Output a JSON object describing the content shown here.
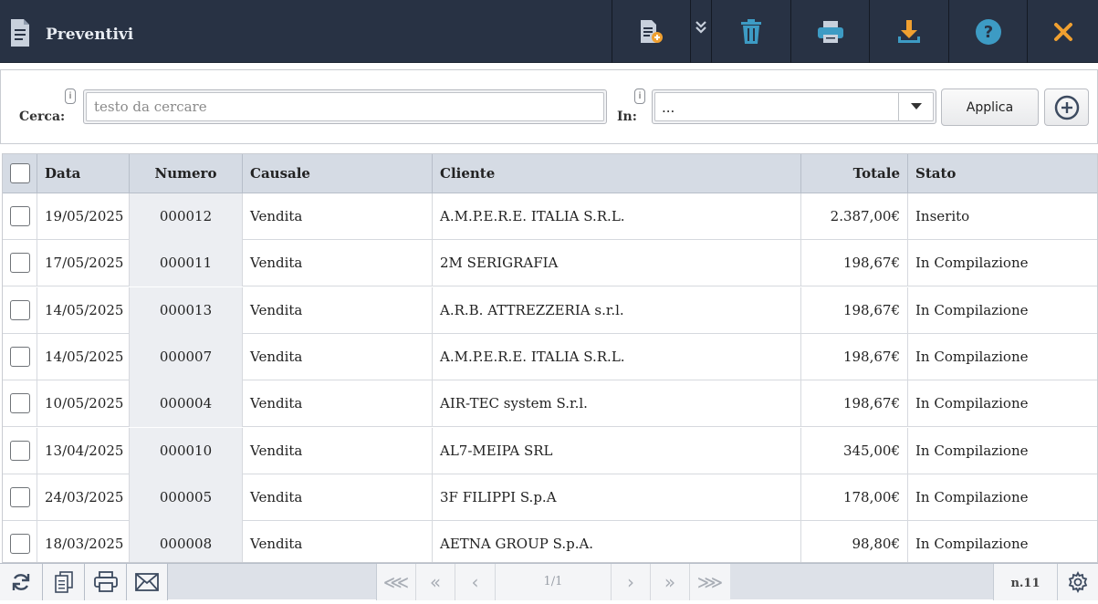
{
  "header": {
    "title": "Preventivi",
    "icons": [
      "document-icon",
      "new-document-icon",
      "expand-more-icon",
      "trash-icon",
      "print-icon",
      "download-icon",
      "help-icon",
      "close-icon"
    ]
  },
  "search": {
    "label": "Cerca:",
    "placeholder": "testo da cercare",
    "info_label": "i",
    "in_label": "In:",
    "in_info_label": "i",
    "in_value": "...",
    "apply_label": "Applica"
  },
  "table": {
    "columns": [
      "Data",
      "Numero",
      "Causale",
      "Cliente",
      "Totale",
      "Stato"
    ],
    "rows": [
      [
        "19/05/2025",
        "000012",
        "Vendita",
        "A.M.P.E.R.E. ITALIA S.R.L.",
        "2.387,00€",
        "Inserito"
      ],
      [
        "17/05/2025",
        "000011",
        "Vendita",
        "2M SERIGRAFIA",
        "198,67€",
        "In Compilazione"
      ],
      [
        "14/05/2025",
        "000013",
        "Vendita",
        "A.R.B. ATTREZZERIA s.r.l.",
        "198,67€",
        "In Compilazione"
      ],
      [
        "14/05/2025",
        "000007",
        "Vendita",
        "A.M.P.E.R.E. ITALIA S.R.L.",
        "198,67€",
        "In Compilazione"
      ],
      [
        "10/05/2025",
        "000004",
        "Vendita",
        "AIR-TEC system S.r.l.",
        "198,67€",
        "In Compilazione"
      ],
      [
        "13/04/2025",
        "000010",
        "Vendita",
        "AL7-MEIPA SRL",
        "345,00€",
        "In Compilazione"
      ],
      [
        "24/03/2025",
        "000005",
        "Vendita",
        "3F FILIPPI S.p.A",
        "178,00€",
        "In Compilazione"
      ],
      [
        "18/03/2025",
        "000008",
        "Vendita",
        "AETNA GROUP S.p.A.",
        "98,80€",
        "In Compilazione"
      ]
    ]
  },
  "footer": {
    "page": "1/1",
    "count": "n.11",
    "pager": {
      "first": "⋘",
      "prev_block": "«",
      "prev": "‹",
      "next": "›",
      "next_block": "»",
      "last": "⋙"
    }
  },
  "colors": {
    "header_bg": "#283244",
    "icon_gray": "#c8d0dc",
    "icon_teal": "#3d9bc4",
    "icon_orange": "#f0a030",
    "table_header_bg": "#d5dbe4"
  }
}
